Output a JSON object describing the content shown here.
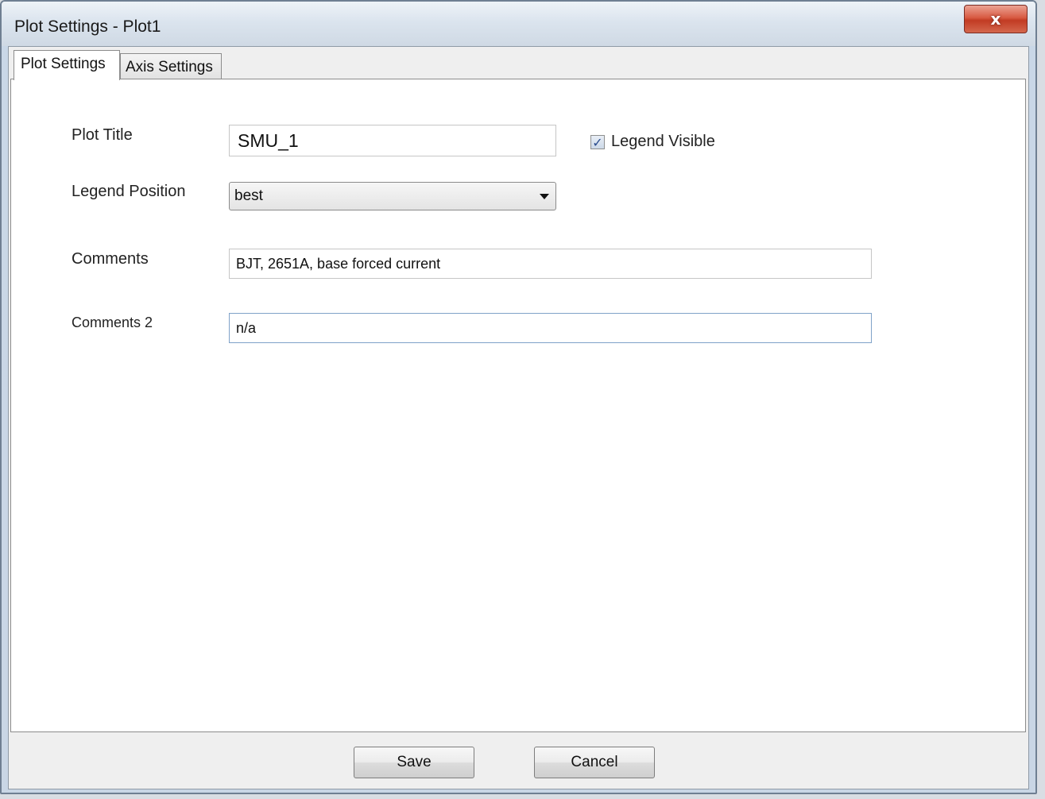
{
  "window": {
    "title": "Plot Settings - Plot1",
    "close_glyph": "x"
  },
  "tabs": [
    {
      "label": "Plot Settings",
      "selected": true
    },
    {
      "label": "Axis Settings",
      "selected": false
    }
  ],
  "form": {
    "plot_title_label": "Plot Title",
    "plot_title_value": "SMU_1",
    "legend_visible_label": "Legend Visible",
    "legend_visible_checked": true,
    "legend_position_label": "Legend Position",
    "legend_position_value": "best",
    "comments_label": "Comments",
    "comments_value": "BJT, 2651A, base forced current",
    "comments2_label": "Comments 2",
    "comments2_value": "n/a"
  },
  "buttons": {
    "save_label": "Save",
    "cancel_label": "Cancel"
  },
  "icons": {
    "close": "close-icon",
    "checkmark": "checkmark-icon",
    "dropdown": "chevron-down-icon"
  }
}
